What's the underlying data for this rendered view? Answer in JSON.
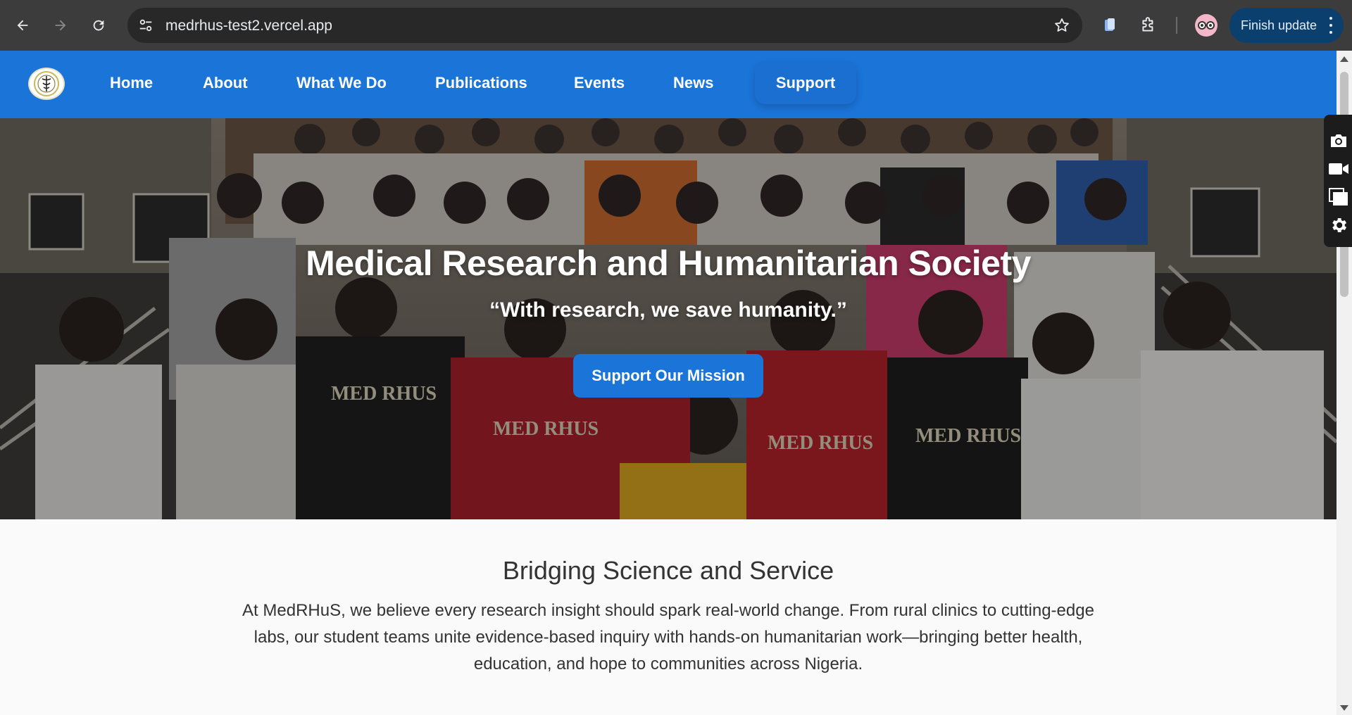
{
  "browser": {
    "url": "medrhus-test2.vercel.app",
    "finish_update_label": "Finish update",
    "icons": {
      "back": "arrow-left-icon",
      "forward": "arrow-right-icon",
      "reload": "reload-icon",
      "site_info": "tune-icon",
      "bookmark": "star-icon",
      "extension_1": "clipboard-icon",
      "extensions": "puzzle-icon",
      "profile": "avatar",
      "menu": "kebab-icon"
    }
  },
  "site": {
    "brand_color": "#1b74d8",
    "nav": [
      {
        "label": "Home"
      },
      {
        "label": "About"
      },
      {
        "label": "What We Do"
      },
      {
        "label": "Publications"
      },
      {
        "label": "Events"
      },
      {
        "label": "News"
      },
      {
        "label": "Support"
      }
    ]
  },
  "hero": {
    "title": "Medical Research and Humanitarian Society",
    "tagline": "“With research, we save humanity.”",
    "cta_label": "Support Our Mission",
    "shirt_print": "MED RHUS"
  },
  "intro": {
    "heading": "Bridging Science and Service",
    "body": "At MedRHuS, we believe every research insight should spark real-world change. From rural clinics to cutting-edge labs, our student teams unite evidence-based inquiry with hands-on humanitarian work—bringing better health, education, and hope to communities across Nigeria."
  },
  "side_tools": [
    "camera-icon",
    "video-icon",
    "window-icon",
    "gear-icon"
  ]
}
